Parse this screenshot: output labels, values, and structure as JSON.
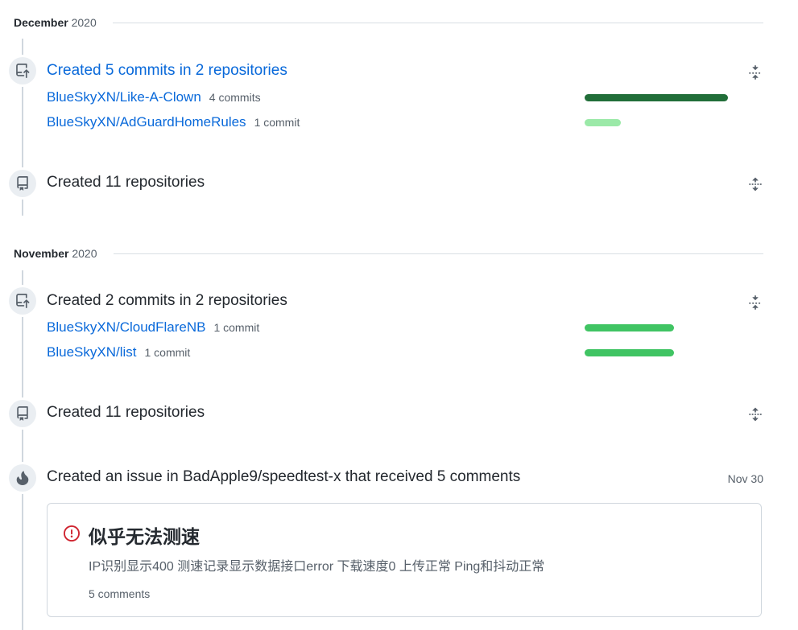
{
  "sections": [
    {
      "month": "December",
      "year": "2020",
      "items": [
        {
          "icon": "repo-push-icon",
          "summary": "Created 5 commits in 2 repositories",
          "repos": [
            {
              "name": "BlueSkyXN/Like-A-Clown",
              "count_label": "4 commits",
              "commits": 4,
              "bar_color": "#216e39"
            },
            {
              "name": "BlueSkyXN/AdGuardHomeRules",
              "count_label": "1 commit",
              "commits": 1,
              "bar_color": "#9be9a8"
            }
          ],
          "toggle_icon": "fold-icon"
        },
        {
          "icon": "repo-icon",
          "summary": "Created 11 repositories",
          "toggle_icon": "unfold-icon"
        }
      ]
    },
    {
      "month": "November",
      "year": "2020",
      "items": [
        {
          "icon": "repo-push-icon",
          "summary": "Created 2 commits in 2 repositories",
          "repos": [
            {
              "name": "BlueSkyXN/CloudFlareNB",
              "count_label": "1 commit",
              "commits": 1,
              "bar_color": "#40c463"
            },
            {
              "name": "BlueSkyXN/list",
              "count_label": "1 commit",
              "commits": 1,
              "bar_color": "#40c463"
            }
          ],
          "toggle_icon": "fold-icon"
        },
        {
          "icon": "repo-icon",
          "summary": "Created 11 repositories",
          "toggle_icon": "unfold-icon"
        },
        {
          "icon": "flame-icon",
          "summary": "Created an issue in BadApple9/speedtest-x that received 5 comments",
          "date": "Nov 30",
          "issue": {
            "icon": "issue-closed-icon",
            "title": "似乎无法测速",
            "body": "IP识别显示400 测速记录显示数据接口error 下载速度0 上传正常 Ping和抖动正常",
            "comments": "5 comments"
          }
        }
      ]
    }
  ],
  "colors": {
    "link": "#0969da",
    "text": "#24292f",
    "muted": "#57606a",
    "border": "#d0d7de",
    "issue_closed": "#cf222e"
  }
}
